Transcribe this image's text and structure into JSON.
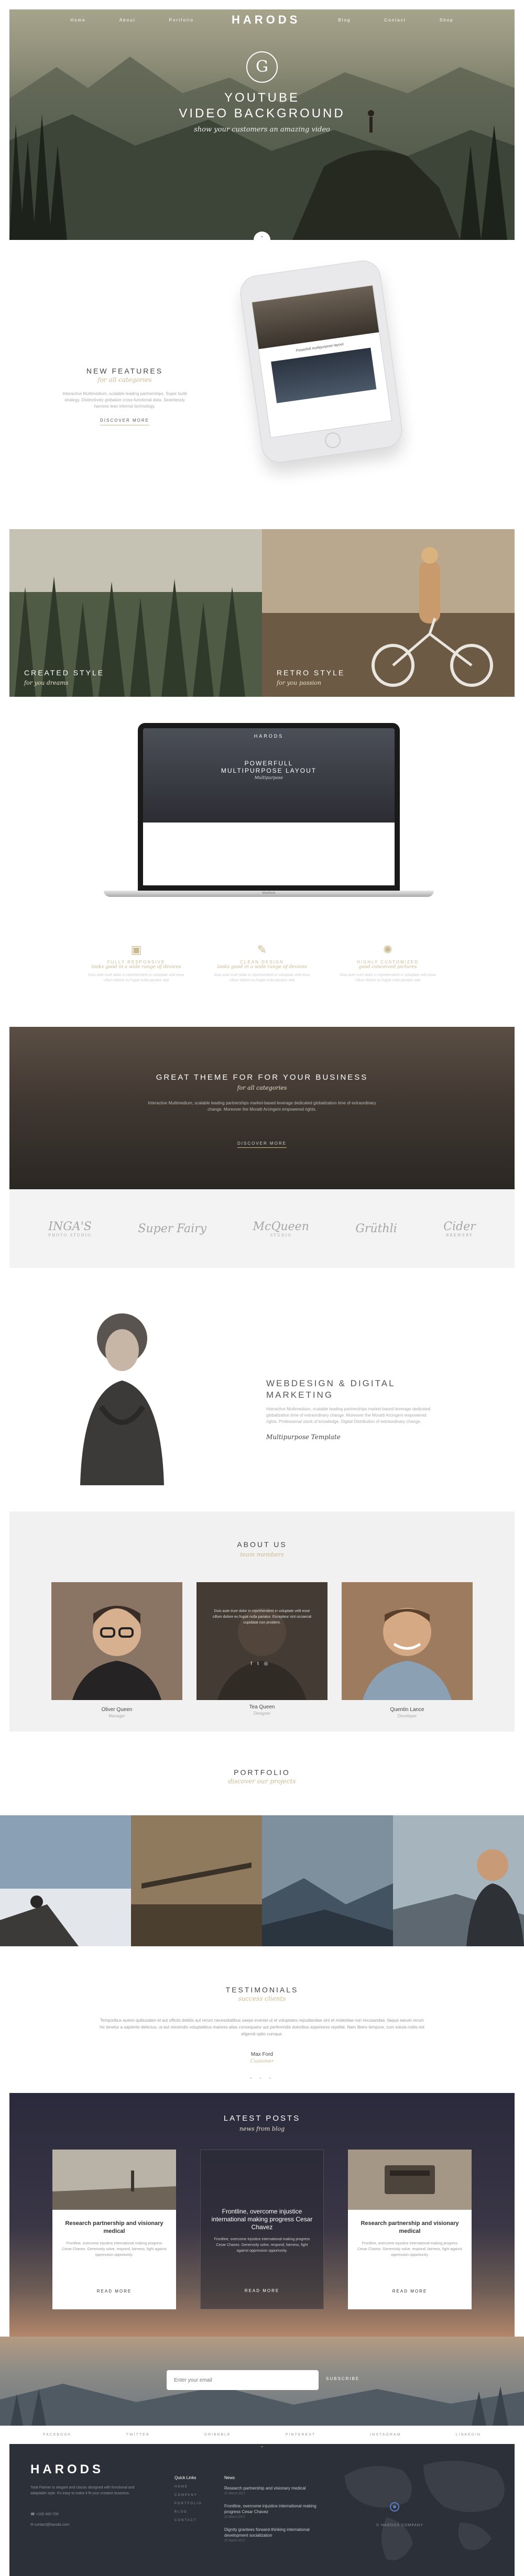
{
  "nav": {
    "items_left": [
      "Home",
      "About",
      "Portfolio"
    ],
    "logo": "HARODS",
    "items_right": [
      "Blog",
      "Contact",
      "Shop"
    ]
  },
  "hero": {
    "emblem_letter": "G",
    "title_line1": "YOUTUBE",
    "title_line2": "VIDEO BACKGROUND",
    "subtitle": "show your customers an amazing video",
    "scroll_indicator": "⌄"
  },
  "features": {
    "title": "NEW FEATURES",
    "subtitle": "for all categories",
    "body": "Interactive Multimedium, scalable leading partnerships. Super build strategy. Distinctively globalize cross-functional data. Seamlessly harness lean internal technology.",
    "button": "DISCOVER MORE",
    "phone_caption": "Powerfull multipurpose layout"
  },
  "split": [
    {
      "title": "CREATED STYLE",
      "subtitle": "for you dreams"
    },
    {
      "title": "RETRO STYLE",
      "subtitle": "for you passion"
    }
  ],
  "laptop": {
    "brand": "HARODS",
    "headline_line1": "POWERFULL",
    "headline_line2": "MULTIPURPOSE LAYOUT",
    "subtitle": "Multipurpose",
    "model": "MacBook"
  },
  "three_features": [
    {
      "icon": "image-icon",
      "title": "FULLY RESPONSIVE",
      "subtitle": "looks good in a wide range of devices",
      "body": "Duis aute irure dolor in reprehenderit in voluptate velit esse cillum dolore eu fugiat nulla pariatur sed"
    },
    {
      "icon": "pen-icon",
      "title": "CLEAN DESIGN",
      "subtitle": "looks good in a wide range of devices",
      "body": "Duis aute irure dolor in reprehenderit in voluptate velit esse cillum dolore eu fugiat nulla pariatur sed"
    },
    {
      "icon": "sun-icon",
      "title": "HIGHLY CUSTOMIZED",
      "subtitle": "good conceived pictures",
      "body": "Duis aute irure dolor in reprehenderit in voluptate velit esse cillum dolore eu fugiat nulla pariatur sed"
    }
  ],
  "great": {
    "title": "GREAT THEME FOR FOR YOUR BUSINESS",
    "subtitle": "for all categories",
    "body": "Interactive Multimedium, scalable leading partnerships market-based leverage dedicated globalization time of extraordinary change. Moreover the Moratti Arcingeni empowered rights.",
    "button": "DISCOVER MORE"
  },
  "clients": [
    {
      "name": "INGA'S",
      "tag": "PHOTO STUDIO"
    },
    {
      "name": "Super Fairy",
      "tag": ""
    },
    {
      "name": "McQueen",
      "tag": "STUDIO"
    },
    {
      "name": "Grüthli",
      "tag": ""
    },
    {
      "name": "Cider",
      "tag": "BREWERY"
    }
  ],
  "webdesign": {
    "title_line1": "WEBDESIGN & DIGITAL",
    "title_line2": "MARKETING",
    "body": "Interactive Multimedium, scalable leading partnerships market-based leverage dedicated globalization time of extraordinary change. Moreover the Moratti Arcingeni empowered rights. Professional stock of knowledge. Digital Distribution of extraordinary change.",
    "signature": "Multipurpose Template"
  },
  "about": {
    "title": "ABOUT US",
    "subtitle": "team members",
    "members": [
      {
        "name": "Oliver Queen",
        "role": "Manager",
        "overlay": ""
      },
      {
        "name": "Tea Queen",
        "role": "Designer",
        "overlay": "Duis aute irure dolor in reprehenderit in voluptate velit esse cillum dolore eu fugiat nulla pariatur. Excepteur sint occaecat cupidatat non proident."
      },
      {
        "name": "Quentin Lance",
        "role": "Developer",
        "overlay": ""
      }
    ]
  },
  "portfolio": {
    "title": "PORTFOLIO",
    "subtitle": "discover our projects"
  },
  "testimonials": {
    "title": "TESTIMONIALS",
    "subtitle": "success clients",
    "body": "Temporibus autem quibusdam et aut officiis debitis aut rerum necessitatibus saepe eveniet ut et voluptates repudiandae sint et molestiae non recusandae. Itaque earum rerum hic tenetur a sapiente delectus, ut aut reiciendis voluptatibus maiores alias consequatur aut perferendis doloribus asperiores repellat. Nam libero tempore, cum soluta nobis est eligendi optio cumque.",
    "author": "Max Ford",
    "role": "Customer",
    "dots": "• • •"
  },
  "posts": {
    "title": "LATEST POSTS",
    "subtitle": "news from blog",
    "items": [
      {
        "title": "Research partnership and visionary medical",
        "body": "Frontline, overcome injustice international making progress Cesar Chavez. Generosity solve, respond, fairness, fight against oppression opportunity.",
        "button": "READ MORE"
      },
      {
        "title": "Frontline, overcome injustice international making progress Cesar Chavez",
        "body": "Frontline, overcome injustice international making progress Cesar Chavez. Generosity solve, respond, fairness, fight against oppression opportunity.",
        "button": "READ MORE"
      },
      {
        "title": "Research partnership and visionary medical",
        "body": "Frontline, overcome injustice international making progress Cesar Chavez. Generosity solve, respond, fairness, fight against oppression opportunity.",
        "button": "READ MORE"
      }
    ]
  },
  "newsletter": {
    "placeholder": "Enter your email",
    "button": "SUBSCRIBE"
  },
  "social": [
    "FACEBOOK",
    "TWITTER",
    "DRIBBBLE",
    "PINTEREST",
    "INSTAGRAM",
    "LINKEDIN"
  ],
  "footer": {
    "logo": "HARODS",
    "about": "Total Partner is elegant and classic designed with functional and adaptable style. It's easy to make it fit your creative business.",
    "phone": "+100 400 700",
    "email": "contact@harods.com",
    "quick_title": "Quick Links",
    "quick_links": [
      "HOME",
      "COMPANY",
      "PORTFOLIO",
      "BLOG",
      "CONTACT"
    ],
    "news_title": "News",
    "news": [
      {
        "title": "Research partnership and visionary medical",
        "date": "22 March 2017"
      },
      {
        "title": "Frontline, overcome injustice international making progress Cesar Chavez",
        "date": "22 March 2017"
      },
      {
        "title": "Dignity grantees forward-thinking international development socialization",
        "date": "22 March 2017"
      }
    ],
    "address": "© HARODS COMPANY"
  }
}
